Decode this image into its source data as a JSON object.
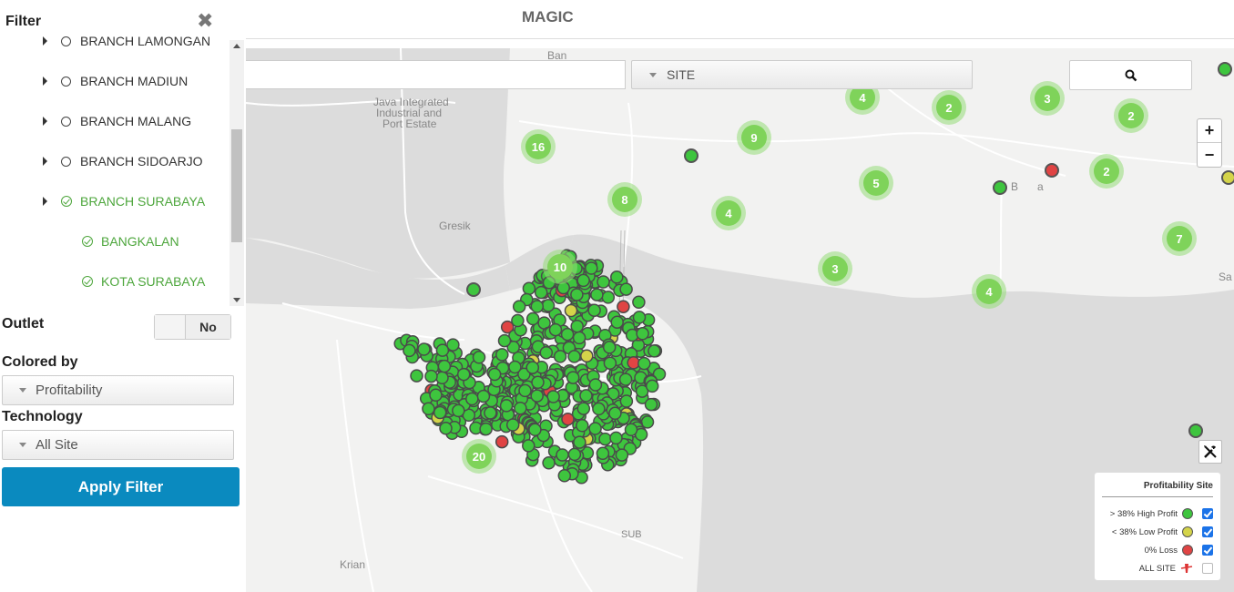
{
  "app": {
    "title": "MAGIC"
  },
  "sidebar": {
    "filter_title": "Filter",
    "close_glyph": "✖",
    "tree": [
      {
        "label": "BRANCH LAMONGAN",
        "state": "radio"
      },
      {
        "label": "BRANCH MADIUN",
        "state": "radio"
      },
      {
        "label": "BRANCH MALANG",
        "state": "radio"
      },
      {
        "label": "BRANCH SIDOARJO",
        "state": "radio"
      },
      {
        "label": "BRANCH SURABAYA",
        "state": "checked"
      },
      {
        "label": "BANGKALAN",
        "state": "checked"
      },
      {
        "label": "KOTA SURABAYA",
        "state": "checked"
      }
    ],
    "outlet_label": "Outlet",
    "outlet_toggle": "No",
    "colored_by_label": "Colored by",
    "colored_by_value": "Profitability",
    "technology_label": "Technology",
    "technology_value": "All Site",
    "apply_button": "Apply Filter"
  },
  "map": {
    "search_placeholder": "",
    "site_select": "SITE",
    "zoom_in": "+",
    "zoom_out": "−",
    "labels": {
      "java": "Java Integrated",
      "industrial": "Industrial and",
      "port": "Port Estate",
      "gresik": "Gresik",
      "bangkalan_cut": "Ban",
      "burneh": "B",
      "burneh2": "a",
      "sub": "SUB",
      "krian": "Krian",
      "sa": "Sa"
    },
    "clusters": [
      "16",
      "9",
      "4",
      "2",
      "3",
      "2",
      "2",
      "8",
      "4",
      "5",
      "7",
      "10",
      "3",
      "4",
      "20"
    ],
    "colors": {
      "green": "#3ec53e",
      "yellow": "#d4d44a",
      "red": "#e04444",
      "cluster": "#7fd35a",
      "apply": "#0a8abf"
    }
  },
  "legend": {
    "title": "Profitability Site",
    "rows": [
      {
        "label": "> 38% High Profit",
        "color": "#3ec53e",
        "checked": true
      },
      {
        "label": "< 38% Low Profit",
        "color": "#d4d44a",
        "checked": true
      },
      {
        "label": "0% Loss",
        "color": "#e04444",
        "checked": true
      },
      {
        "label": "ALL SITE",
        "color": "",
        "checked": false
      }
    ]
  }
}
